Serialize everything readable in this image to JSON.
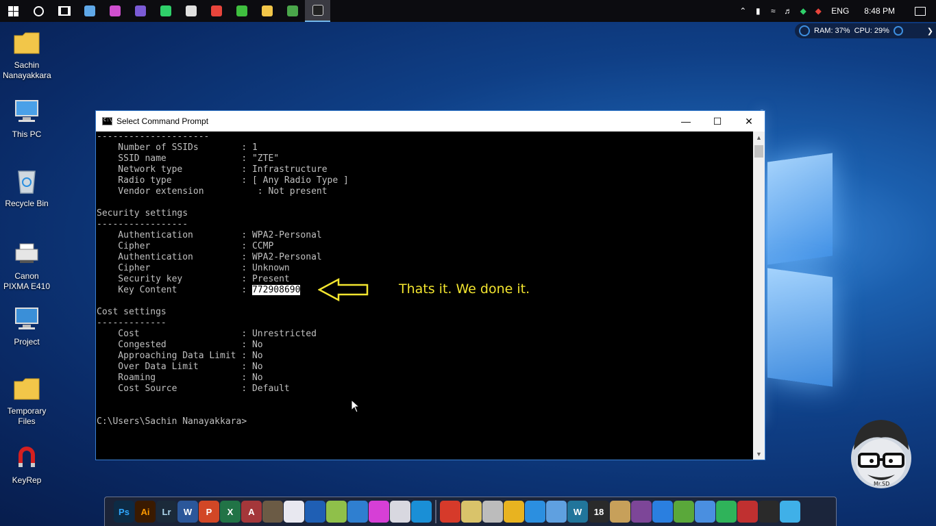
{
  "taskbar": {
    "pinned": [
      {
        "name": "cortana-icon"
      },
      {
        "name": "task-view-icon"
      },
      {
        "name": "virtualbox-icon",
        "color": "#5fa8e8"
      },
      {
        "name": "itunes-icon",
        "color": "#d04fd0"
      },
      {
        "name": "viber-icon",
        "color": "#7b5bd6"
      },
      {
        "name": "whatsapp-icon",
        "color": "#2fd06a"
      },
      {
        "name": "film-icon",
        "color": "#e0e0e0"
      },
      {
        "name": "app-red-icon",
        "color": "#e8453c"
      },
      {
        "name": "camtasia-icon",
        "color": "#3fbf3f"
      },
      {
        "name": "file-explorer-icon",
        "color": "#f2c649"
      },
      {
        "name": "chrome-icon",
        "color": "#4aa64a"
      },
      {
        "name": "command-prompt-icon",
        "color": "#222222"
      }
    ],
    "tray": {
      "language": "ENG",
      "time": "8:48 PM"
    }
  },
  "sysmon": {
    "ram": "RAM: 37%",
    "cpu": "CPU: 29%"
  },
  "desktop_icons": [
    {
      "label": "Sachin\nNanayakkara",
      "icon": "user-folder-icon"
    },
    {
      "label": "This PC",
      "icon": "this-pc-icon"
    },
    {
      "label": "Recycle Bin",
      "icon": "recycle-bin-icon"
    },
    {
      "label": "Canon\nPIXMA E410",
      "icon": "printer-icon"
    },
    {
      "label": "Project",
      "icon": "network-project-icon"
    },
    {
      "label": "Temporary\nFiles",
      "icon": "folder-add-icon"
    },
    {
      "label": "KeyRep",
      "icon": "magnet-icon"
    }
  ],
  "cmd": {
    "title": "Select Command Prompt",
    "lines": [
      "---------------------",
      "    Number of SSIDs        : 1",
      "    SSID name              : \"ZTE\"",
      "    Network type           : Infrastructure",
      "    Radio type             : [ Any Radio Type ]",
      "    Vendor extension          : Not present",
      "",
      "Security settings",
      "-----------------",
      "    Authentication         : WPA2-Personal",
      "    Cipher                 : CCMP",
      "    Authentication         : WPA2-Personal",
      "    Cipher                 : Unknown",
      "    Security key           : Present",
      "    Key Content            : ",
      "",
      "Cost settings",
      "-------------",
      "    Cost                   : Unrestricted",
      "    Congested              : No",
      "    Approaching Data Limit : No",
      "    Over Data Limit        : No",
      "    Roaming                : No",
      "    Cost Source            : Default",
      "",
      "",
      "C:\\Users\\Sachin Nanayakkara>"
    ],
    "key_content": "772908690"
  },
  "annotation": {
    "text": "Thats it. We done it."
  },
  "dock": {
    "items": [
      {
        "name": "photoshop-icon",
        "label": "Ps",
        "color": "#0d2b45",
        "text": "#31a8ff"
      },
      {
        "name": "illustrator-icon",
        "label": "Ai",
        "color": "#3a1a00",
        "text": "#ff9a00"
      },
      {
        "name": "lightroom-icon",
        "label": "Lr",
        "color": "#1b2a3a",
        "text": "#add5ec"
      },
      {
        "name": "word-icon",
        "label": "W",
        "color": "#2b579a",
        "text": "#ffffff"
      },
      {
        "name": "powerpoint-icon",
        "label": "P",
        "color": "#d24726",
        "text": "#ffffff"
      },
      {
        "name": "excel-icon",
        "label": "X",
        "color": "#217346",
        "text": "#ffffff"
      },
      {
        "name": "access-icon",
        "label": "A",
        "color": "#a4373a",
        "text": "#ffffff"
      },
      {
        "name": "gimp-icon",
        "label": "",
        "color": "#6b5b45",
        "text": "#ffffff"
      },
      {
        "name": "media-player-icon",
        "label": "",
        "color": "#e8e8f0",
        "text": "#2a6fd6"
      },
      {
        "name": "visual-studio-icon",
        "label": "",
        "color": "#1f5fb4",
        "text": "#ffffff"
      },
      {
        "name": "notepad-plus-icon",
        "label": "",
        "color": "#8fc04a",
        "text": "#ffffff"
      },
      {
        "name": "openoffice-icon",
        "label": "",
        "color": "#2f7fd0",
        "text": "#ffffff"
      },
      {
        "name": "winamp-icon",
        "label": "",
        "color": "#d63fd6",
        "text": "#ffffff"
      },
      {
        "name": "pdf-icon",
        "label": "",
        "color": "#d8d8e0",
        "text": "#8a2be2"
      },
      {
        "name": "ccleaner-icon",
        "label": "",
        "color": "#1a8fd6",
        "text": "#ffffff"
      },
      {
        "name": "filezilla-icon",
        "label": "",
        "color": "#d63a2a",
        "text": "#ffffff"
      },
      {
        "name": "tools-icon",
        "label": "",
        "color": "#d9c36a",
        "text": "#ffffff"
      },
      {
        "name": "lock-icon",
        "label": "",
        "color": "#bcbcbc",
        "text": "#ffffff"
      },
      {
        "name": "keys-icon",
        "label": "",
        "color": "#e8b320",
        "text": "#ffffff"
      },
      {
        "name": "arc-icon",
        "label": "",
        "color": "#2b8fe0",
        "text": "#ffffff"
      },
      {
        "name": "window-app-icon",
        "label": "",
        "color": "#5fa0e0",
        "text": "#ffffff"
      },
      {
        "name": "wordpress-icon",
        "label": "W",
        "color": "#21759b",
        "text": "#ffffff"
      },
      {
        "name": "age18-icon",
        "label": "18",
        "color": "#2a2a2a",
        "text": "#ffffff"
      },
      {
        "name": "lamp-icon",
        "label": "",
        "color": "#c7a05a",
        "text": "#ffffff"
      },
      {
        "name": "tor-icon",
        "label": "",
        "color": "#7d4698",
        "text": "#ffffff"
      },
      {
        "name": "remote-icon",
        "label": "",
        "color": "#2a7fe0",
        "text": "#ffffff"
      },
      {
        "name": "utorrent-icon",
        "label": "",
        "color": "#5aa83a",
        "text": "#ffffff"
      },
      {
        "name": "camera-icon",
        "label": "",
        "color": "#4a8fe0",
        "text": "#ffffff"
      },
      {
        "name": "phone-icon",
        "label": "",
        "color": "#2fb35a",
        "text": "#ffffff"
      },
      {
        "name": "media-red-icon",
        "label": "",
        "color": "#c03030",
        "text": "#ffffff"
      },
      {
        "name": "madhura-icon",
        "label": "",
        "color": "#2a2a2a",
        "text": "#ffffff"
      },
      {
        "name": "bird-icon",
        "label": "",
        "color": "#3fb0e8",
        "text": "#ffffff"
      }
    ]
  },
  "avatar": {
    "label": "Mr.SD"
  }
}
